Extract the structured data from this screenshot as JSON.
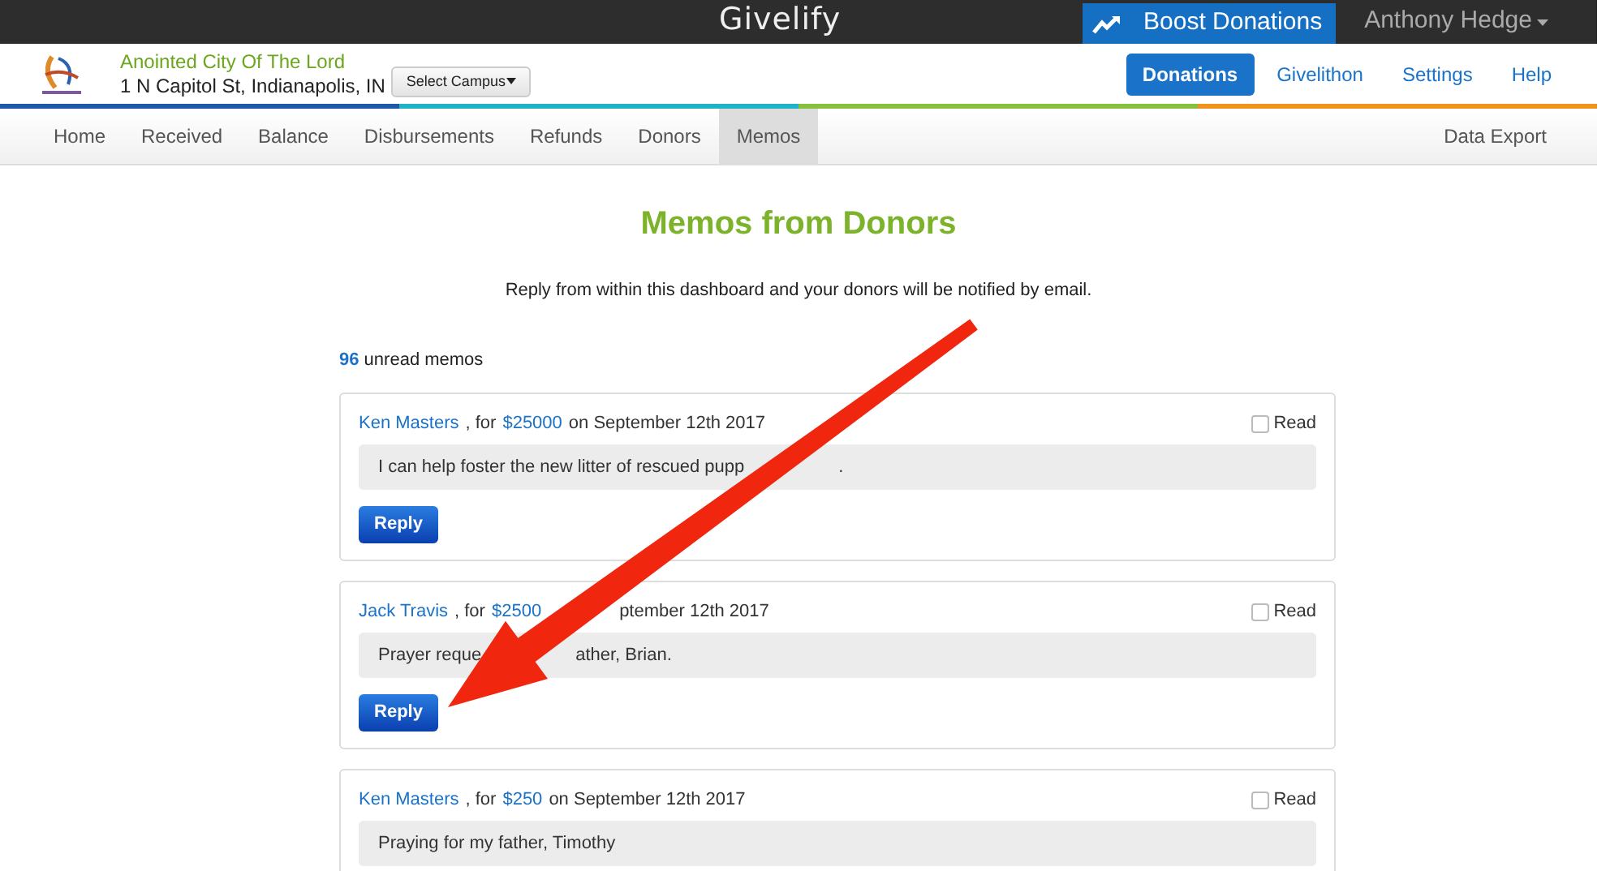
{
  "topbar": {
    "brand": "Givelify",
    "boost": "Boost Donations",
    "user": "Anthony Hedge"
  },
  "header": {
    "org_name": "Anointed City Of The Lord",
    "address": "1 N Capitol St, Indianapolis, IN",
    "campus_button": "Select Campus",
    "links": [
      {
        "label": "Donations",
        "selected": true
      },
      {
        "label": "Givelithon",
        "selected": false
      },
      {
        "label": "Settings",
        "selected": false
      },
      {
        "label": "Help",
        "selected": false
      }
    ]
  },
  "nav": {
    "items": [
      {
        "label": "Home",
        "selected": false
      },
      {
        "label": "Received",
        "selected": false
      },
      {
        "label": "Balance",
        "selected": false
      },
      {
        "label": "Disbursements",
        "selected": false
      },
      {
        "label": "Refunds",
        "selected": false
      },
      {
        "label": "Donors",
        "selected": false
      },
      {
        "label": "Memos",
        "selected": true
      }
    ],
    "right": "Data Export"
  },
  "page": {
    "title": "Memos from Donors",
    "subtitle": "Reply from within this dashboard and your donors will be notified by email.",
    "unread_count": "96",
    "unread_label": "unread memos"
  },
  "memos": [
    {
      "header": [
        {
          "kind": "link",
          "text": "Ken Masters"
        },
        {
          "kind": "text",
          "text": ", for"
        },
        {
          "kind": "link",
          "text": "$25000"
        },
        {
          "kind": "text",
          "text": "on September 12th 2017"
        }
      ],
      "read": {
        "label": "Read",
        "checked": false
      },
      "message": [
        "I can help foster the new litter of rescued pupp",
        "."
      ],
      "reply": "Reply"
    },
    {
      "header": [
        {
          "kind": "link",
          "text": "Jack Travis"
        },
        {
          "kind": "text",
          "text": ", for"
        },
        {
          "kind": "link",
          "text": "$2500"
        },
        {
          "kind": "fragment",
          "text": "ptember 12th 2017"
        }
      ],
      "read": {
        "label": "Read",
        "checked": false
      },
      "message": [
        "Prayer reque",
        "ather, Brian."
      ],
      "reply": "Reply"
    },
    {
      "header": [
        {
          "kind": "link",
          "text": "Ken Masters"
        },
        {
          "kind": "text",
          "text": ", for"
        },
        {
          "kind": "link",
          "text": "$250"
        },
        {
          "kind": "text",
          "text": "on September 12th 2017"
        }
      ],
      "read": {
        "label": "Read",
        "checked": false
      },
      "message": [
        "Praying for my father, Timothy"
      ]
    }
  ]
}
